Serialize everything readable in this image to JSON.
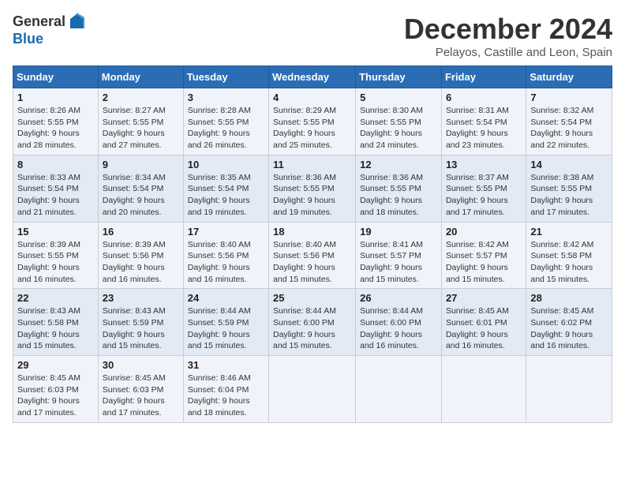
{
  "logo": {
    "general": "General",
    "blue": "Blue"
  },
  "header": {
    "month": "December 2024",
    "location": "Pelayos, Castille and Leon, Spain"
  },
  "weekdays": [
    "Sunday",
    "Monday",
    "Tuesday",
    "Wednesday",
    "Thursday",
    "Friday",
    "Saturday"
  ],
  "weeks": [
    [
      {
        "day": "1",
        "sunrise": "Sunrise: 8:26 AM",
        "sunset": "Sunset: 5:55 PM",
        "daylight": "Daylight: 9 hours and 28 minutes."
      },
      {
        "day": "2",
        "sunrise": "Sunrise: 8:27 AM",
        "sunset": "Sunset: 5:55 PM",
        "daylight": "Daylight: 9 hours and 27 minutes."
      },
      {
        "day": "3",
        "sunrise": "Sunrise: 8:28 AM",
        "sunset": "Sunset: 5:55 PM",
        "daylight": "Daylight: 9 hours and 26 minutes."
      },
      {
        "day": "4",
        "sunrise": "Sunrise: 8:29 AM",
        "sunset": "Sunset: 5:55 PM",
        "daylight": "Daylight: 9 hours and 25 minutes."
      },
      {
        "day": "5",
        "sunrise": "Sunrise: 8:30 AM",
        "sunset": "Sunset: 5:55 PM",
        "daylight": "Daylight: 9 hours and 24 minutes."
      },
      {
        "day": "6",
        "sunrise": "Sunrise: 8:31 AM",
        "sunset": "Sunset: 5:54 PM",
        "daylight": "Daylight: 9 hours and 23 minutes."
      },
      {
        "day": "7",
        "sunrise": "Sunrise: 8:32 AM",
        "sunset": "Sunset: 5:54 PM",
        "daylight": "Daylight: 9 hours and 22 minutes."
      }
    ],
    [
      {
        "day": "8",
        "sunrise": "Sunrise: 8:33 AM",
        "sunset": "Sunset: 5:54 PM",
        "daylight": "Daylight: 9 hours and 21 minutes."
      },
      {
        "day": "9",
        "sunrise": "Sunrise: 8:34 AM",
        "sunset": "Sunset: 5:54 PM",
        "daylight": "Daylight: 9 hours and 20 minutes."
      },
      {
        "day": "10",
        "sunrise": "Sunrise: 8:35 AM",
        "sunset": "Sunset: 5:54 PM",
        "daylight": "Daylight: 9 hours and 19 minutes."
      },
      {
        "day": "11",
        "sunrise": "Sunrise: 8:36 AM",
        "sunset": "Sunset: 5:55 PM",
        "daylight": "Daylight: 9 hours and 19 minutes."
      },
      {
        "day": "12",
        "sunrise": "Sunrise: 8:36 AM",
        "sunset": "Sunset: 5:55 PM",
        "daylight": "Daylight: 9 hours and 18 minutes."
      },
      {
        "day": "13",
        "sunrise": "Sunrise: 8:37 AM",
        "sunset": "Sunset: 5:55 PM",
        "daylight": "Daylight: 9 hours and 17 minutes."
      },
      {
        "day": "14",
        "sunrise": "Sunrise: 8:38 AM",
        "sunset": "Sunset: 5:55 PM",
        "daylight": "Daylight: 9 hours and 17 minutes."
      }
    ],
    [
      {
        "day": "15",
        "sunrise": "Sunrise: 8:39 AM",
        "sunset": "Sunset: 5:55 PM",
        "daylight": "Daylight: 9 hours and 16 minutes."
      },
      {
        "day": "16",
        "sunrise": "Sunrise: 8:39 AM",
        "sunset": "Sunset: 5:56 PM",
        "daylight": "Daylight: 9 hours and 16 minutes."
      },
      {
        "day": "17",
        "sunrise": "Sunrise: 8:40 AM",
        "sunset": "Sunset: 5:56 PM",
        "daylight": "Daylight: 9 hours and 16 minutes."
      },
      {
        "day": "18",
        "sunrise": "Sunrise: 8:40 AM",
        "sunset": "Sunset: 5:56 PM",
        "daylight": "Daylight: 9 hours and 15 minutes."
      },
      {
        "day": "19",
        "sunrise": "Sunrise: 8:41 AM",
        "sunset": "Sunset: 5:57 PM",
        "daylight": "Daylight: 9 hours and 15 minutes."
      },
      {
        "day": "20",
        "sunrise": "Sunrise: 8:42 AM",
        "sunset": "Sunset: 5:57 PM",
        "daylight": "Daylight: 9 hours and 15 minutes."
      },
      {
        "day": "21",
        "sunrise": "Sunrise: 8:42 AM",
        "sunset": "Sunset: 5:58 PM",
        "daylight": "Daylight: 9 hours and 15 minutes."
      }
    ],
    [
      {
        "day": "22",
        "sunrise": "Sunrise: 8:43 AM",
        "sunset": "Sunset: 5:58 PM",
        "daylight": "Daylight: 9 hours and 15 minutes."
      },
      {
        "day": "23",
        "sunrise": "Sunrise: 8:43 AM",
        "sunset": "Sunset: 5:59 PM",
        "daylight": "Daylight: 9 hours and 15 minutes."
      },
      {
        "day": "24",
        "sunrise": "Sunrise: 8:44 AM",
        "sunset": "Sunset: 5:59 PM",
        "daylight": "Daylight: 9 hours and 15 minutes."
      },
      {
        "day": "25",
        "sunrise": "Sunrise: 8:44 AM",
        "sunset": "Sunset: 6:00 PM",
        "daylight": "Daylight: 9 hours and 15 minutes."
      },
      {
        "day": "26",
        "sunrise": "Sunrise: 8:44 AM",
        "sunset": "Sunset: 6:00 PM",
        "daylight": "Daylight: 9 hours and 16 minutes."
      },
      {
        "day": "27",
        "sunrise": "Sunrise: 8:45 AM",
        "sunset": "Sunset: 6:01 PM",
        "daylight": "Daylight: 9 hours and 16 minutes."
      },
      {
        "day": "28",
        "sunrise": "Sunrise: 8:45 AM",
        "sunset": "Sunset: 6:02 PM",
        "daylight": "Daylight: 9 hours and 16 minutes."
      }
    ],
    [
      {
        "day": "29",
        "sunrise": "Sunrise: 8:45 AM",
        "sunset": "Sunset: 6:03 PM",
        "daylight": "Daylight: 9 hours and 17 minutes."
      },
      {
        "day": "30",
        "sunrise": "Sunrise: 8:45 AM",
        "sunset": "Sunset: 6:03 PM",
        "daylight": "Daylight: 9 hours and 17 minutes."
      },
      {
        "day": "31",
        "sunrise": "Sunrise: 8:46 AM",
        "sunset": "Sunset: 6:04 PM",
        "daylight": "Daylight: 9 hours and 18 minutes."
      },
      null,
      null,
      null,
      null
    ]
  ]
}
